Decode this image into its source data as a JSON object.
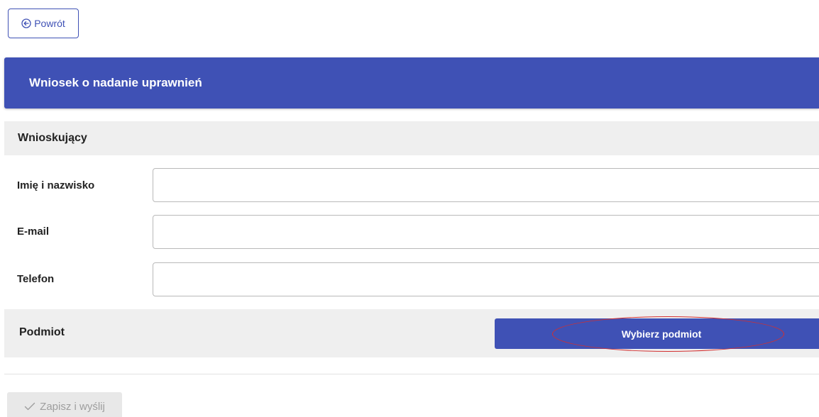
{
  "back_button": {
    "label": "Powrót",
    "icon": "arrow-left-circle-icon"
  },
  "header": {
    "title": "Wniosek o nadanie uprawnień",
    "color": "#3f51b5"
  },
  "applicant_section": {
    "title": "Wnioskujący",
    "fields": [
      {
        "label": "Imię i nazwisko",
        "value": ""
      },
      {
        "label": "E-mail",
        "value": ""
      },
      {
        "label": "Telefon",
        "value": ""
      }
    ]
  },
  "entity_section": {
    "label": "Podmiot",
    "select_button_label": "Wybierz podmiot",
    "highlight_color": "#d32f2f"
  },
  "submit_button": {
    "label": "Zapisz i wyślij",
    "icon": "check-icon",
    "disabled": true
  }
}
